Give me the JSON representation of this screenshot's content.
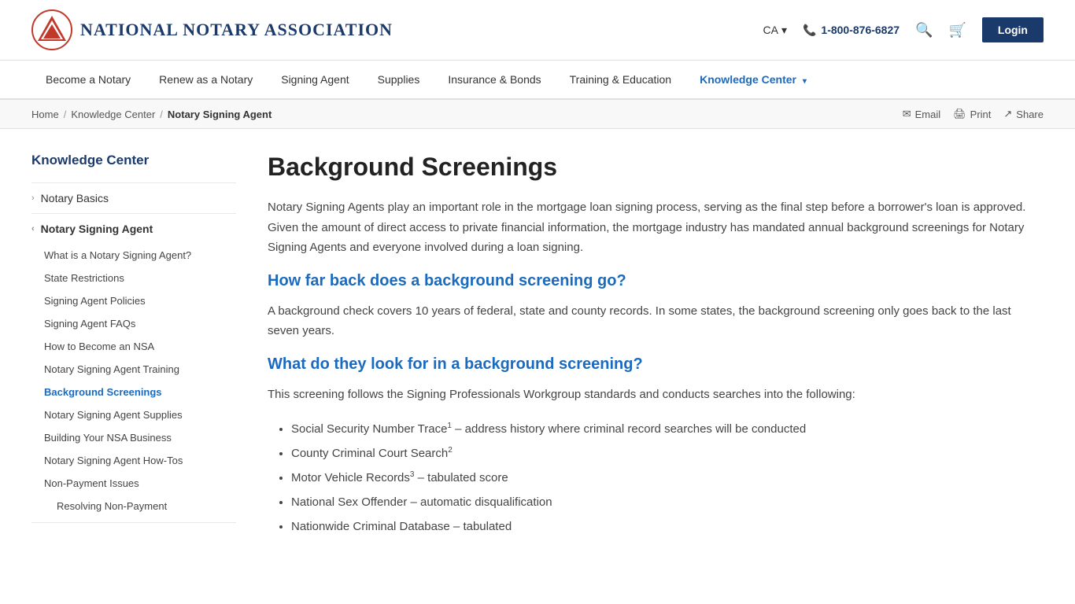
{
  "header": {
    "logo_text": "National Notary Association",
    "region": "CA",
    "phone": "1-800-876-6827",
    "login_label": "Login",
    "search_label": "Search",
    "cart_label": "Cart"
  },
  "nav": {
    "items": [
      {
        "label": "Become a Notary",
        "active": false
      },
      {
        "label": "Renew as a Notary",
        "active": false
      },
      {
        "label": "Signing Agent",
        "active": false
      },
      {
        "label": "Supplies",
        "active": false
      },
      {
        "label": "Insurance & Bonds",
        "active": false
      },
      {
        "label": "Training & Education",
        "active": false
      },
      {
        "label": "Knowledge Center",
        "active": true,
        "has_dropdown": true
      }
    ]
  },
  "breadcrumb": {
    "home": "Home",
    "knowledge_center": "Knowledge Center",
    "current": "Notary Signing Agent"
  },
  "breadcrumb_actions": {
    "email": "Email",
    "print": "Print",
    "share": "Share"
  },
  "sidebar": {
    "title": "Knowledge Center",
    "items": [
      {
        "label": "Notary Basics",
        "expanded": false,
        "chevron": "›"
      },
      {
        "label": "Notary Signing Agent",
        "expanded": true,
        "chevron": "‹",
        "sub_items": [
          {
            "label": "What is a Notary Signing Agent?",
            "active": false
          },
          {
            "label": "State Restrictions",
            "active": false
          },
          {
            "label": "Signing Agent Policies",
            "active": false
          },
          {
            "label": "Signing Agent FAQs",
            "active": false
          },
          {
            "label": "How to Become an NSA",
            "active": false
          },
          {
            "label": "Notary Signing Agent Training",
            "active": false
          },
          {
            "label": "Background Screenings",
            "active": true
          },
          {
            "label": "Notary Signing Agent Supplies",
            "active": false
          },
          {
            "label": "Building Your NSA Business",
            "active": false
          },
          {
            "label": "Notary Signing Agent How-Tos",
            "active": false
          },
          {
            "label": "Non-Payment Issues",
            "active": false
          }
        ]
      }
    ],
    "sub_sub_items": [
      {
        "label": "Resolving Non-Payment"
      }
    ]
  },
  "article": {
    "title": "Background Screenings",
    "intro": "Notary Signing Agents play an important role in the mortgage loan signing process, serving as the final step before a borrower's loan is approved. Given the amount of direct access to private financial information, the mortgage industry has mandated annual background screenings for Notary Signing Agents and everyone involved during a loan signing.",
    "sections": [
      {
        "heading": "How far back does a background screening go?",
        "body": "A background check covers 10 years of federal, state and county records. In some states, the background screening only goes back to the last seven years."
      },
      {
        "heading": "What do they look for in a background screening?",
        "body": "This screening follows the Signing Professionals Workgroup standards and conducts searches into the following:",
        "list": [
          {
            "text": "Social Security Number Trace",
            "sup": "1",
            "note": " – address history where criminal record searches will be conducted"
          },
          {
            "text": "County Criminal Court Search",
            "sup": "2",
            "note": ""
          },
          {
            "text": "Motor Vehicle Records",
            "sup": "3",
            "note": " – tabulated score"
          },
          {
            "text": "National Sex Offender – automatic disqualification",
            "sup": "",
            "note": ""
          },
          {
            "text": "Nationwide Criminal Database – tabulated",
            "sup": "",
            "note": ""
          }
        ]
      }
    ]
  },
  "colors": {
    "brand_blue": "#1a3a6b",
    "link_blue": "#1a6bbf",
    "active_nav": "#1a6bbf",
    "red": "#c0392b"
  }
}
